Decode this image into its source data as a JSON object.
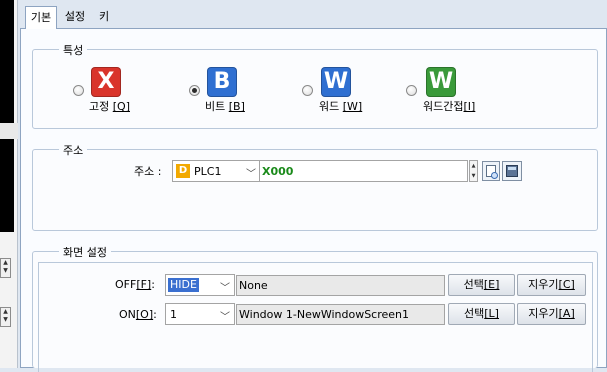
{
  "tabs": [
    {
      "label": "기본"
    },
    {
      "label": "설정"
    },
    {
      "label": "키"
    }
  ],
  "properties": {
    "title": "특성",
    "options": [
      {
        "label": "고정",
        "key": "[Q]",
        "icon_letter": "X",
        "icon_color": "#d9342b",
        "checked": false
      },
      {
        "label": "비트",
        "key": "[B]",
        "icon_letter": "B",
        "icon_color": "#2f6fd1",
        "checked": true
      },
      {
        "label": "워드",
        "key": "[W]",
        "icon_letter": "W",
        "icon_color": "#2f6fd1",
        "checked": false
      },
      {
        "label": "워드간접",
        "key": "[I]",
        "icon_letter": "W",
        "icon_color": "#3a9a3a",
        "checked": false
      }
    ]
  },
  "address": {
    "title": "주소",
    "label": "주소 :",
    "device_prefix": "D",
    "device": "PLC1",
    "value": "X000",
    "value_color": "#1a8a1a"
  },
  "display": {
    "title": "화면 설정",
    "rows": [
      {
        "label": "OFF",
        "key": "[F]",
        "suffix": ":",
        "select": "HIDE",
        "value": "None",
        "select_btn": "선택",
        "select_key": "[E]",
        "clear_btn": "지우기",
        "clear_key": "[C]"
      },
      {
        "label": "ON",
        "key": "[O]",
        "suffix": ":",
        "select": "1",
        "value": "Window 1-NewWindowScreen1",
        "select_btn": "선택",
        "select_key": "[L]",
        "clear_btn": "지우기",
        "clear_key": "[A]"
      }
    ]
  }
}
